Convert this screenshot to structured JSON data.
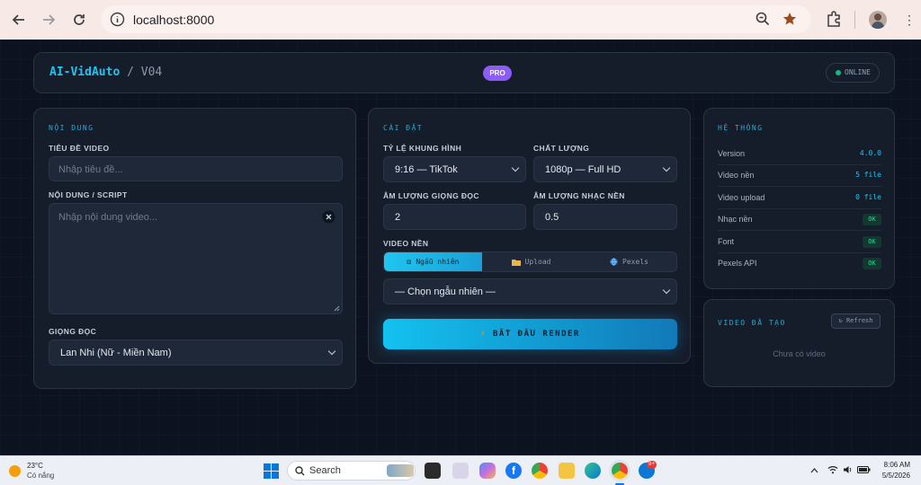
{
  "browser": {
    "url": "localhost:8000"
  },
  "header": {
    "brand_name": "AI-VidAuto",
    "brand_sep": " / ",
    "brand_version": "V04",
    "pro_badge": "PRO",
    "status": "ONLINE"
  },
  "content_card": {
    "title": "NỘI DUNG",
    "video_title_label": "TIÊU ĐỀ VIDEO",
    "video_title_placeholder": "Nhập tiêu đề...",
    "script_label": "NỘI DUNG / SCRIPT",
    "script_placeholder": "Nhập nội dung video...",
    "voice_label": "GIỌNG ĐỌC",
    "voice_value": "Lan Nhi (Nữ - Miền Nam)"
  },
  "settings_card": {
    "title": "CÀI ĐẶT",
    "aspect_label": "TỶ LỆ KHUNG HÌNH",
    "aspect_value": "9:16 — TikTok",
    "quality_label": "CHẤT LƯỢNG",
    "quality_value": "1080p — Full HD",
    "voice_volume_label": "ÂM LƯỢNG GIỌNG ĐỌC",
    "voice_volume_value": "2",
    "music_volume_label": "ÂM LƯỢNG NHẠC NỀN",
    "music_volume_value": "0.5",
    "bg_video_label": "VIDEO NỀN",
    "tabs": [
      {
        "label": "Ngẫu nhiên",
        "icon": "dice-icon",
        "active": true
      },
      {
        "label": "Upload",
        "icon": "folder-icon",
        "active": false
      },
      {
        "label": "Pexels",
        "icon": "globe-icon",
        "active": false
      }
    ],
    "bg_select_value": "— Chọn ngẫu nhiên —",
    "render_button": "BẮT ĐẦU RENDER"
  },
  "system_card": {
    "title": "HỆ THỐNG",
    "rows": [
      {
        "key": "Version",
        "value": "4.0.0",
        "type": "text"
      },
      {
        "key": "Video nền",
        "value": "5 file",
        "type": "text"
      },
      {
        "key": "Video upload",
        "value": "0 file",
        "type": "text"
      },
      {
        "key": "Nhạc nền",
        "value": "OK",
        "type": "ok"
      },
      {
        "key": "Font",
        "value": "OK",
        "type": "ok"
      },
      {
        "key": "Pexels API",
        "value": "OK",
        "type": "ok"
      }
    ]
  },
  "videos_card": {
    "title": "VIDEO ĐÃ TẠO",
    "refresh_button": "↻ Refresh",
    "empty_text": "Chưa có video"
  },
  "taskbar": {
    "temperature": "23°C",
    "weather": "Có nắng",
    "search_label": "Search",
    "time": "8:06 AM",
    "date": "5/5/2026",
    "notification_badge": "9+"
  },
  "colors": {
    "accent": "#21c4f0",
    "pro": "#8b5cf6",
    "online": "#10b981",
    "ok": "#34d399"
  }
}
